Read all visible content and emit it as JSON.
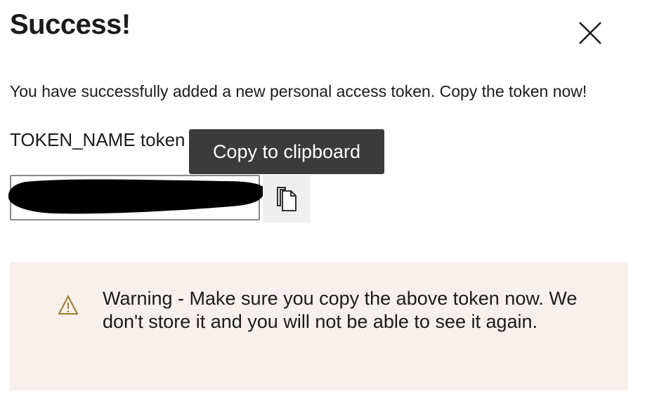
{
  "dialog": {
    "title": "Success!",
    "close_icon": "close-icon",
    "message": "You have successfully added a new personal access token. Copy the token now!",
    "token_name_line": "TOKEN_NAME token",
    "token_value_redacted": true,
    "copy_button": {
      "icon": "copy-icon",
      "tooltip": "Copy to clipboard"
    },
    "warning": {
      "icon": "warning-icon",
      "text": "Warning - Make sure you copy the above token now. We don't store it and you will not be able to see it again."
    }
  },
  "colors": {
    "text": "#1b1b1b",
    "tooltip_bg": "#3b3b3b",
    "warning_bg": "#f8f0ec",
    "warning_icon": "#a57d2a",
    "copy_button_bg": "#efefef",
    "field_border": "#8a8886"
  }
}
